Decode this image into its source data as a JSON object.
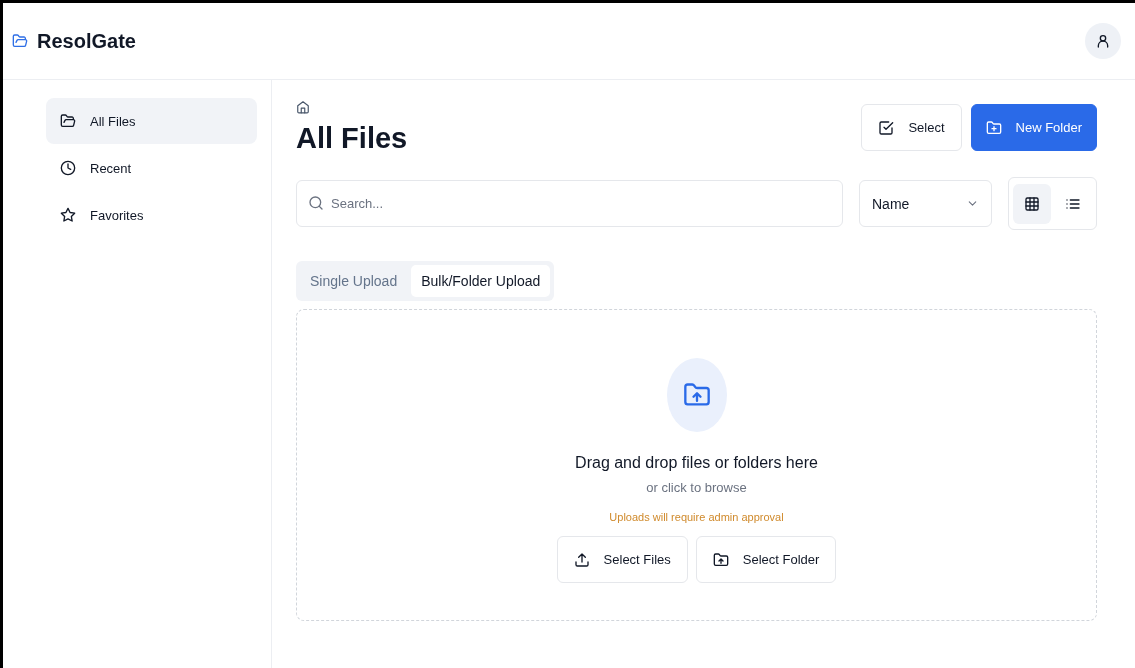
{
  "app": {
    "title": "ResolGate"
  },
  "sidebar": {
    "items": [
      {
        "label": "All Files",
        "kind": "folder",
        "selected": true
      },
      {
        "label": "Recent",
        "kind": "clock",
        "selected": false
      },
      {
        "label": "Favorites",
        "kind": "star",
        "selected": false
      }
    ]
  },
  "page": {
    "title": "All Files",
    "actions": [
      {
        "label": "Select",
        "kind": "secondary"
      },
      {
        "label": "New Folder",
        "kind": "primary"
      }
    ]
  },
  "search": {
    "placeholder": "Search..."
  },
  "sort": {
    "value": "Name"
  },
  "views": [
    {
      "kind": "grid",
      "selected": true
    },
    {
      "kind": "list",
      "selected": false
    }
  ],
  "upload_tabs": [
    {
      "label": "Single Upload",
      "selected": false
    },
    {
      "label": "Bulk/Folder Upload",
      "selected": true
    }
  ],
  "dropzone": {
    "heading": "Drag and drop files or folders here",
    "subtext": "or click to browse",
    "notice": "Uploads will require admin approval",
    "buttons": [
      {
        "label": "Select Files",
        "kind": "files"
      },
      {
        "label": "Select Folder",
        "kind": "folder"
      }
    ]
  }
}
